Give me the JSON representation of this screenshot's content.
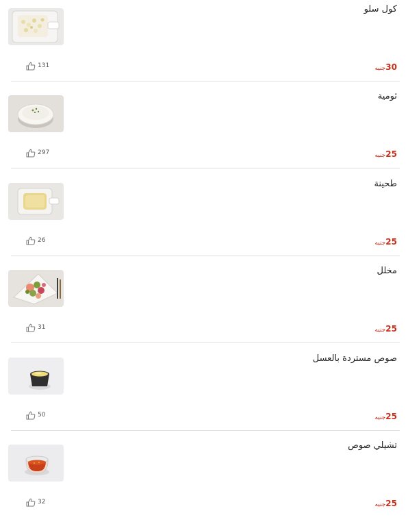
{
  "menu": {
    "items": [
      {
        "title": "كول سلو",
        "price": "30",
        "currency": "جنيه",
        "likes": "131",
        "image": "coleslaw-photo"
      },
      {
        "title": "ثومية",
        "price": "25",
        "currency": "جنيه",
        "likes": "297",
        "image": "garlic-sauce-photo"
      },
      {
        "title": "طحينة",
        "price": "25",
        "currency": "جنيه",
        "likes": "26",
        "image": "tahini-photo"
      },
      {
        "title": "مخلل",
        "price": "25",
        "currency": "جنيه",
        "likes": "31",
        "image": "pickles-photo"
      },
      {
        "title": "صوص مستردة بالعسل",
        "price": "25",
        "currency": "جنيه",
        "likes": "50",
        "image": "honey-mustard-photo"
      },
      {
        "title": "تشيلي صوص",
        "price": "25",
        "currency": "جنيه",
        "likes": "32",
        "image": "chili-sauce-photo"
      }
    ]
  },
  "colors": {
    "price": "#c8301e",
    "divider": "#e2e2e2",
    "like_icon": "#777777"
  },
  "icons": {
    "like": "thumbs-up-icon"
  }
}
